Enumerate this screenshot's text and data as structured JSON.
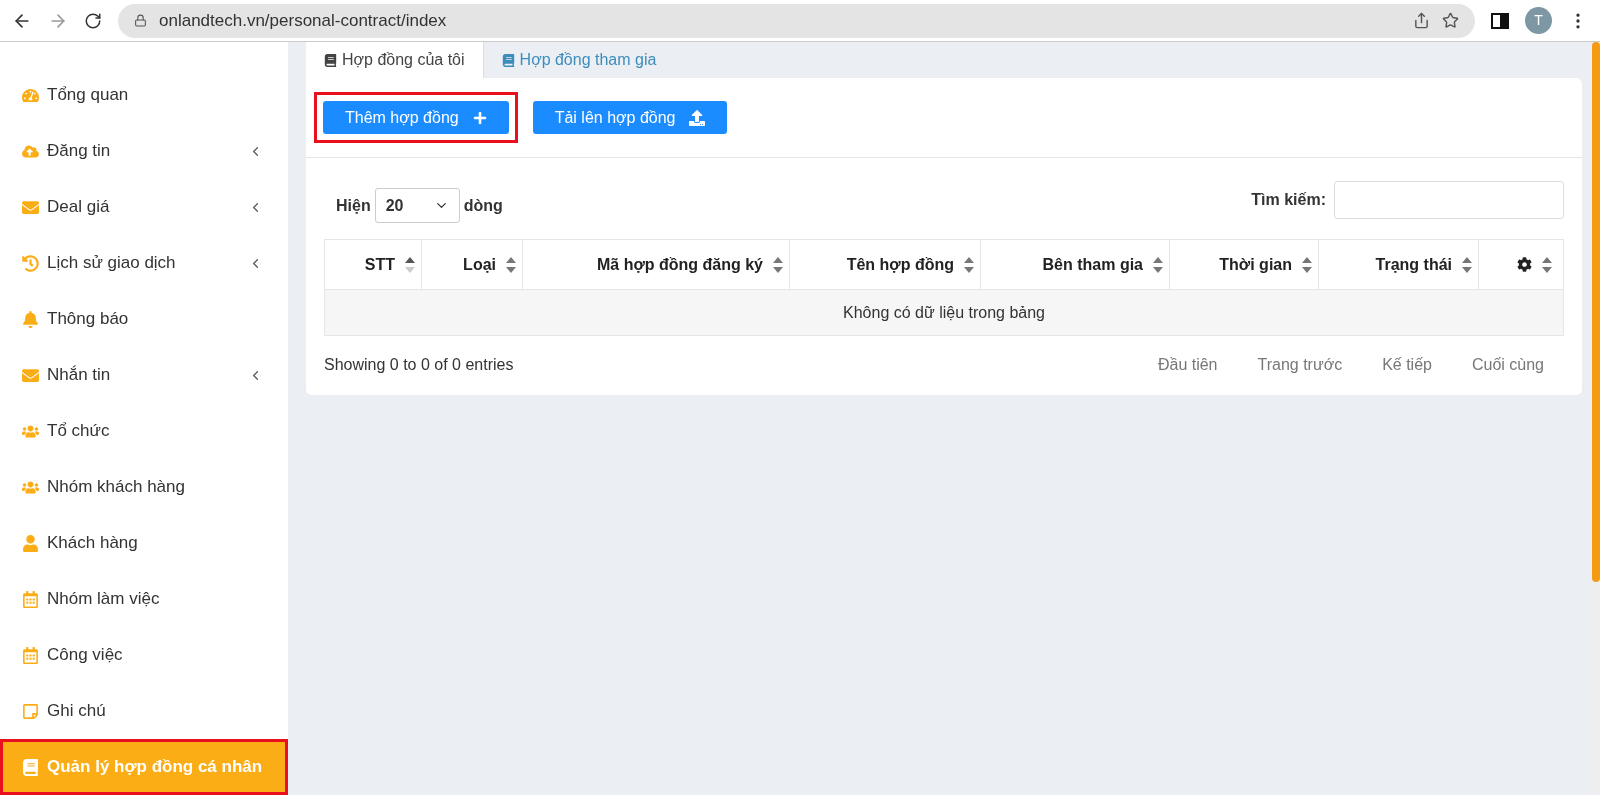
{
  "browser": {
    "url": "onlandtech.vn/personal-contract/index",
    "profile_initial": "T"
  },
  "sidebar": {
    "items": [
      {
        "label": "Tổng quan",
        "has_submenu": false,
        "selected": false,
        "highlighted": false
      },
      {
        "label": "Đăng tin",
        "has_submenu": true,
        "selected": false,
        "highlighted": false
      },
      {
        "label": "Deal giá",
        "has_submenu": true,
        "selected": false,
        "highlighted": false
      },
      {
        "label": "Lịch sử giao dịch",
        "has_submenu": true,
        "selected": false,
        "highlighted": false
      },
      {
        "label": "Thông báo",
        "has_submenu": false,
        "selected": false,
        "highlighted": false
      },
      {
        "label": "Nhắn tin",
        "has_submenu": true,
        "selected": false,
        "highlighted": false
      },
      {
        "label": "Tổ chức",
        "has_submenu": false,
        "selected": false,
        "highlighted": false
      },
      {
        "label": "Nhóm khách hàng",
        "has_submenu": false,
        "selected": false,
        "highlighted": false
      },
      {
        "label": "Khách hàng",
        "has_submenu": false,
        "selected": false,
        "highlighted": false
      },
      {
        "label": "Nhóm làm việc",
        "has_submenu": false,
        "selected": false,
        "highlighted": false
      },
      {
        "label": "Công việc",
        "has_submenu": false,
        "selected": false,
        "highlighted": false
      },
      {
        "label": "Ghi chú",
        "has_submenu": false,
        "selected": false,
        "highlighted": false
      },
      {
        "label": "Quản lý hợp đồng cá nhân",
        "has_submenu": false,
        "selected": true,
        "highlighted": true
      }
    ]
  },
  "tabs": [
    {
      "label": "Hợp đồng của tôi",
      "selected": true
    },
    {
      "label": "Hợp đồng tham gia",
      "selected": false
    }
  ],
  "actions": [
    {
      "label": "Thêm hợp đồng",
      "highlighted": true
    },
    {
      "label": "Tải lên hợp đồng",
      "highlighted": false
    }
  ],
  "length_menu": {
    "prefix": "Hiện",
    "value": "20",
    "suffix": "dòng"
  },
  "search": {
    "label": "Tìm kiếm:"
  },
  "table": {
    "columns": [
      {
        "label": "STT",
        "sorted": true
      },
      {
        "label": "Loại",
        "sorted": false
      },
      {
        "label": "Mã hợp đồng đăng ký",
        "sorted": false
      },
      {
        "label": "Tên hợp đồng",
        "sorted": false
      },
      {
        "label": "Bên tham gia",
        "sorted": false
      },
      {
        "label": "Thời gian",
        "sorted": false
      },
      {
        "label": "Trạng thái",
        "sorted": false
      },
      {
        "kind": "settings",
        "sorted": false
      }
    ],
    "empty_message": "Không có dữ liệu trong bảng"
  },
  "info": "Showing 0 to 0 of 0 entries",
  "pagination": [
    "Đầu tiên",
    "Trang trước",
    "Kế tiếp",
    "Cuối cùng"
  ]
}
